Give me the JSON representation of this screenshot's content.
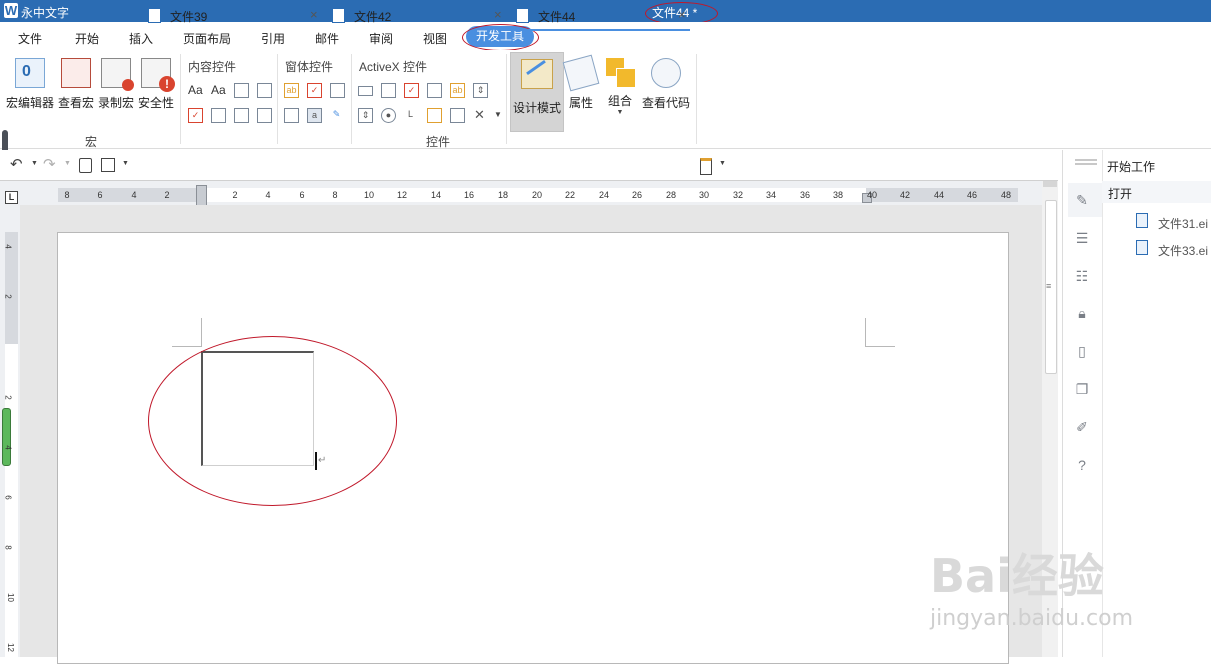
{
  "app": {
    "name": "永中文字",
    "doc_title": "文件44 *"
  },
  "menu": [
    "文件",
    "开始",
    "插入",
    "页面布局",
    "引用",
    "邮件",
    "审阅",
    "视图",
    "开发工具"
  ],
  "ribbon": {
    "macro_buttons": [
      "宏编辑器",
      "查看宏",
      "录制宏",
      "安全性"
    ],
    "group_macro": "宏",
    "content_controls": "内容控件",
    "form_controls": "窗体控件",
    "activex_controls": "ActiveX 控件",
    "group_controls": "控件",
    "design_mode": "设计模式",
    "properties": "属性",
    "group": "组合",
    "view_code": "查看代码",
    "aa1": "Aa",
    "aa2": "Aa"
  },
  "tabs": [
    {
      "label": "文件39"
    },
    {
      "label": "文件42"
    },
    {
      "label": "文件44",
      "active": true
    }
  ],
  "ruler": {
    "top_numbers": [
      "8",
      "6",
      "4",
      "2",
      "2",
      "4",
      "6",
      "8",
      "10",
      "12",
      "14",
      "16",
      "18",
      "20",
      "22",
      "24",
      "26",
      "28",
      "30",
      "32",
      "34",
      "36",
      "38",
      "40",
      "42",
      "44",
      "46",
      "48"
    ],
    "left_numbers": [
      "4",
      "2",
      "2",
      "4",
      "6",
      "8",
      "10",
      "12"
    ]
  },
  "panel": {
    "title": "开始工作",
    "open": "打开",
    "recent": [
      "文件31.ei",
      "文件33.ei"
    ]
  },
  "watermark": {
    "brand": "Bai经验",
    "url": "jingyan.baidu.com"
  },
  "colors": {
    "title_bar": "#2b6cb3",
    "accent": "#4a8fe0",
    "annotation": "#c0182a"
  }
}
